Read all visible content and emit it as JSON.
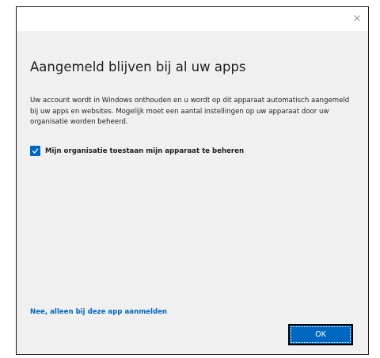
{
  "dialog": {
    "close_glyph": "×",
    "heading": "Aangemeld blijven bij al uw apps",
    "description": "Uw account wordt in Windows onthouden en u wordt op dit apparaat automatisch aangemeld bij uw apps en websites. Mogelijk moet een aantal instellingen op uw apparaat door uw organisatie worden beheerd.",
    "checkbox": {
      "checked": true,
      "label": "Mijn organisatie toestaan mijn apparaat te beheren"
    },
    "link": "Nee, alleen bij deze app aanmelden",
    "ok_label": "OK"
  },
  "colors": {
    "accent": "#0067c0",
    "background": "#f0f0f0",
    "text": "#1e1e1e"
  },
  "icons": {
    "close": "close-icon",
    "checkmark": "checkmark-icon"
  }
}
